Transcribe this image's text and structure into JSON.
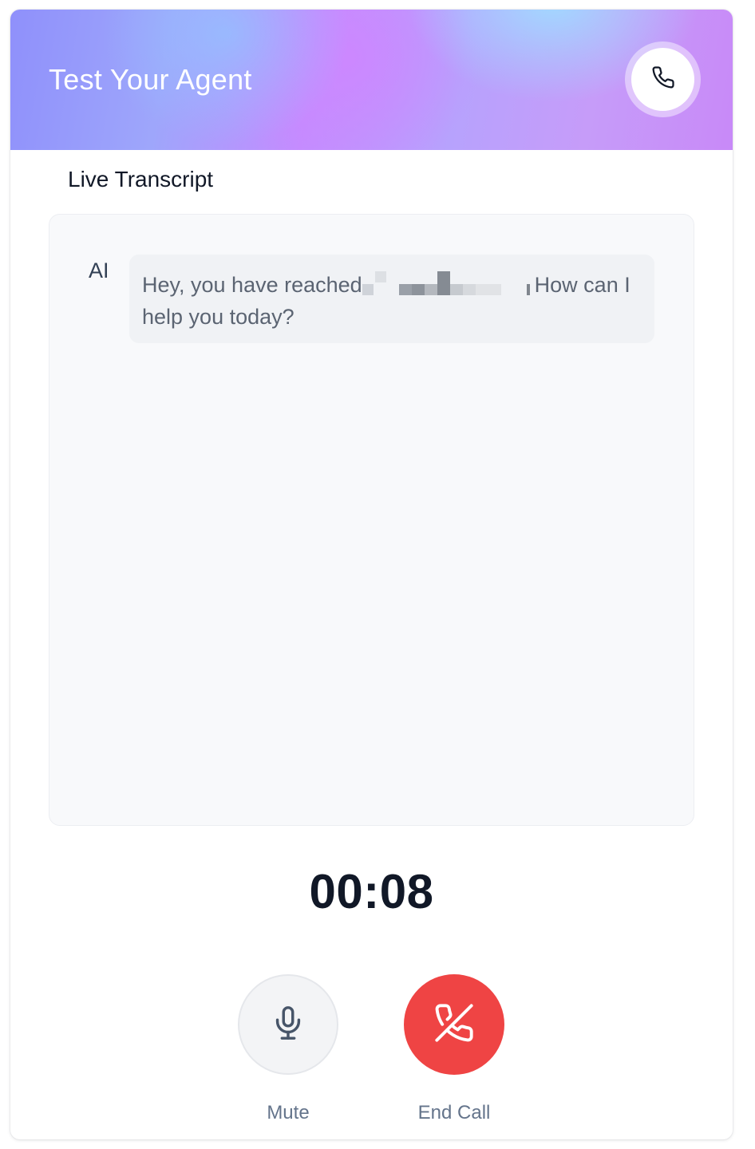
{
  "header": {
    "title": "Test Your Agent",
    "call_icon": "phone-icon"
  },
  "transcript": {
    "label": "Live Transcript",
    "messages": [
      {
        "speaker": "AI",
        "text_before": "Hey, you have reached",
        "text_after": "How can I help you today?"
      }
    ]
  },
  "timer": "00:08",
  "controls": {
    "mute": {
      "label": "Mute",
      "icon": "microphone-icon"
    },
    "end_call": {
      "label": "End Call",
      "icon": "phone-off-icon",
      "color": "#ef4444"
    }
  },
  "colors": {
    "header_gradient": [
      "#8f90fb",
      "#c38cff",
      "#a0dcff",
      "#c889f8"
    ],
    "end_call_red": "#ef4444"
  }
}
